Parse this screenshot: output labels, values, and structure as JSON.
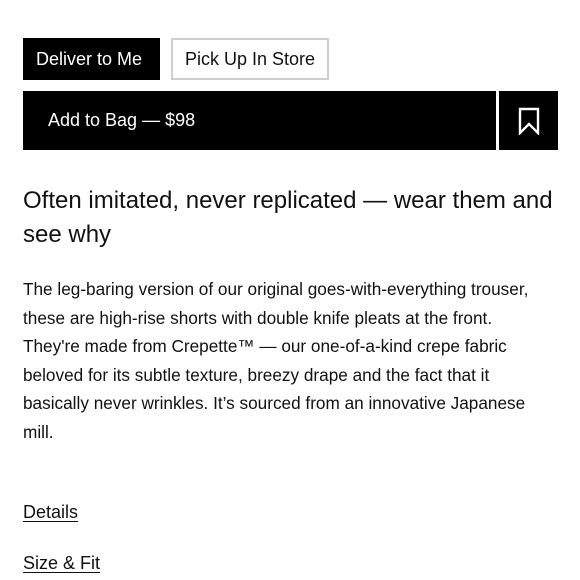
{
  "fulfillment": {
    "deliver_label": "Deliver to Me",
    "pickup_label": "Pick Up In Store",
    "selected": "Deliver to Me"
  },
  "purchase": {
    "add_to_bag_label": "Add to Bag — $98",
    "bookmark_icon": "bookmark-icon"
  },
  "product": {
    "headline": "Often imitated, never replicated — wear them and see why",
    "description": "The leg-baring version of our original goes-with-everything trouser, these are high-rise shorts with double knife pleats at the front. They're made from Crepette™ — our one-of-a-kind crepe fabric beloved for its subtle texture, breezy drape and the fact that it basically never wrinkles. It’s sourced from an innovative Japanese mill."
  },
  "links": {
    "details_label": "Details",
    "size_fit_label": "Size & Fit"
  },
  "colors": {
    "primary": "#000000",
    "text": "#111111",
    "border": "#cfcfcf",
    "background": "#ffffff"
  }
}
